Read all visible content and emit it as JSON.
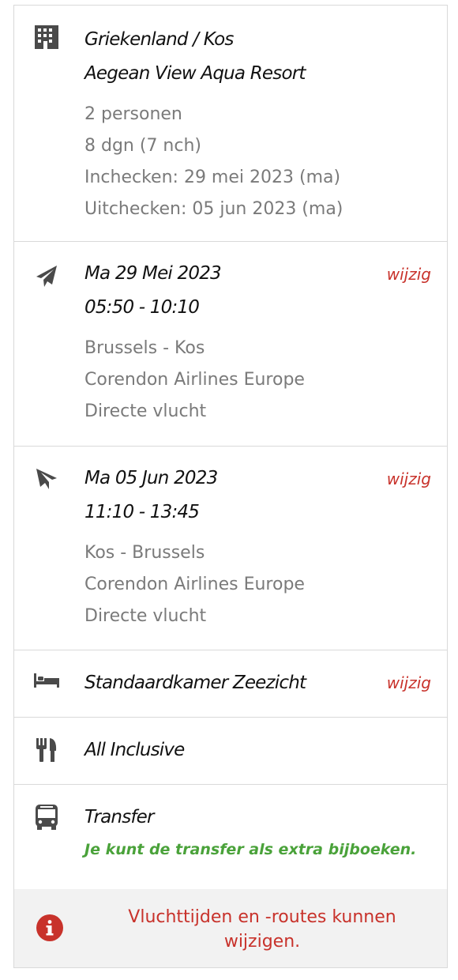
{
  "hotel": {
    "location": "Griekenland  /  Kos",
    "name": "Aegean View Aqua Resort",
    "persons": "2 personen",
    "duration": "8 dgn (7 nch)",
    "checkin": "Inchecken: 29 mei 2023 (ma)",
    "checkout": "Uitchecken: 05 jun 2023 (ma)",
    "icon": "building-icon"
  },
  "outbound": {
    "date": "Ma 29 Mei 2023",
    "time": "05:50 - 10:10",
    "route": "Brussels - Kos",
    "airline": "Corendon Airlines Europe",
    "type": "Directe vlucht",
    "change_label": "wijzig",
    "icon": "plane-departure-icon"
  },
  "return": {
    "date": "Ma 05 Jun 2023",
    "time": "11:10 - 13:45",
    "route": "Kos - Brussels",
    "airline": "Corendon Airlines Europe",
    "type": "Directe vlucht",
    "change_label": "wijzig",
    "icon": "plane-arrival-icon"
  },
  "room": {
    "name": "Standaardkamer Zeezicht",
    "change_label": "wijzig",
    "icon": "bed-icon"
  },
  "board": {
    "name": "All Inclusive",
    "icon": "fork-knife-icon"
  },
  "transfer": {
    "name": "Transfer",
    "note": "Je kunt de transfer als extra bijboeken.",
    "icon": "bus-icon"
  },
  "notice": {
    "text": "Vluchttijden en -routes kunnen wijzigen.",
    "icon": "info-icon"
  },
  "colors": {
    "accent_red": "#c8322b",
    "green": "#4aa23a",
    "icon_gray": "#4a4a4a",
    "text_gray": "#7a7a7a"
  }
}
